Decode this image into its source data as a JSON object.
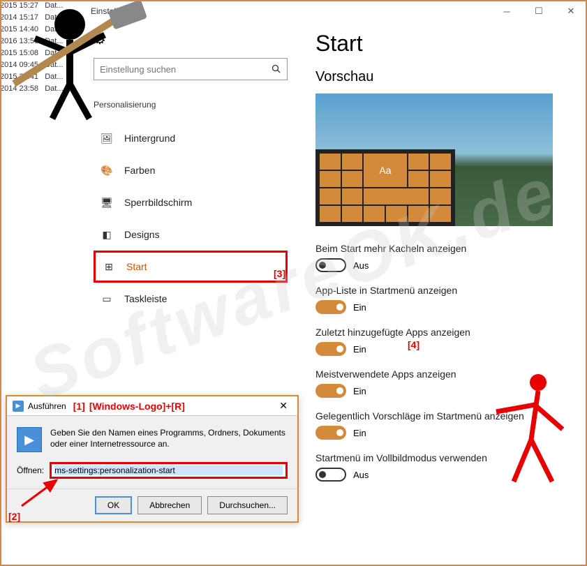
{
  "bg_dates": [
    "2015 15:27",
    "2014 15:17",
    "2015 14:40",
    "2016 13:56",
    "2015 15:08",
    "2014 09:45",
    "2015 22:41",
    "2014 23:58"
  ],
  "bg_date_suffix": "Dat...",
  "settings": {
    "window_title": "Einstellungen",
    "search_placeholder": "Einstellung suchen",
    "section": "Personalisierung",
    "nav": [
      {
        "icon": "🖼",
        "label": "Hintergrund"
      },
      {
        "icon": "🎨",
        "label": "Farben"
      },
      {
        "icon": "🖥",
        "label": "Sperrbildschirm"
      },
      {
        "icon": "◧",
        "label": "Designs"
      },
      {
        "icon": "⊞",
        "label": "Start"
      },
      {
        "icon": "▭",
        "label": "Taskleiste"
      }
    ],
    "selected_index": 4
  },
  "right": {
    "title": "Start",
    "preview_heading": "Vorschau",
    "preview_tile_text": "Aa",
    "toggles": [
      {
        "label": "Beim Start mehr Kacheln anzeigen",
        "on": false,
        "state": "Aus"
      },
      {
        "label": "App-Liste in Startmenü anzeigen",
        "on": true,
        "state": "Ein"
      },
      {
        "label": "Zuletzt hinzugefügte Apps anzeigen",
        "on": true,
        "state": "Ein"
      },
      {
        "label": "Meistverwendete Apps anzeigen",
        "on": true,
        "state": "Ein"
      },
      {
        "label": "Gelegentlich Vorschläge im Startmenü anzeigen",
        "on": true,
        "state": "Ein"
      },
      {
        "label": "Startmenü im Vollbildmodus verwenden",
        "on": false,
        "state": "Aus"
      }
    ]
  },
  "run": {
    "title": "Ausführen",
    "desc": "Geben Sie den Namen eines Programms, Ordners, Dokuments oder einer Internetressource an.",
    "open_label": "Öffnen:",
    "open_value": "ms-settings:personalization-start",
    "ok": "OK",
    "cancel": "Abbrechen",
    "browse": "Durchsuchen..."
  },
  "annotations": {
    "a1": "[1]",
    "a1_hint": "[Windows-Logo]+[R]",
    "a2": "[2]",
    "a3": "[3]",
    "a4": "[4]"
  },
  "watermark": "SoftwareOK.de"
}
